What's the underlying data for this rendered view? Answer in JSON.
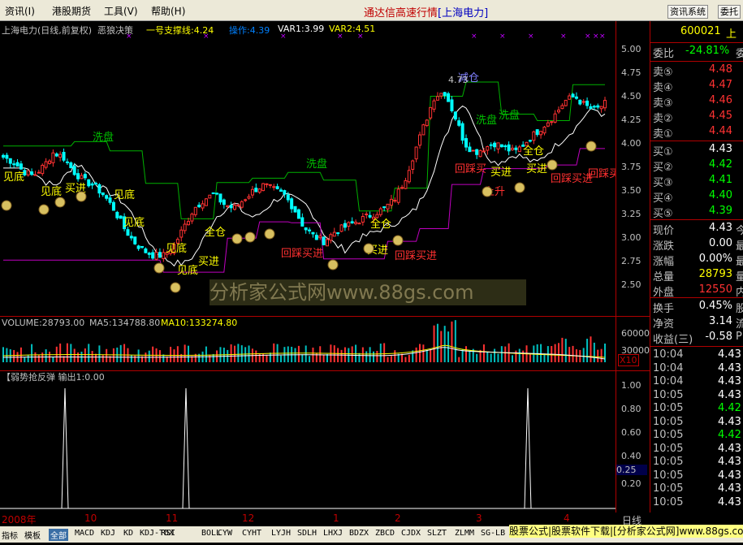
{
  "menu": {
    "items": [
      "资讯(I)",
      "港股期货",
      "工具(V)",
      "帮助(H)"
    ],
    "title": "通达信高速行情",
    "stock_label": "[上海电力]",
    "btn1": "资讯系统",
    "btn2": "委托"
  },
  "header": {
    "stock": "上海电力(日线,前复权)",
    "formula": "恶狼决策",
    "support": "一号支撑线:4.24",
    "op": "操作:4.39",
    "var1": "VAR1:3.99",
    "var2": "VAR2:4.51"
  },
  "price_axis": [
    "5.00",
    "4.75",
    "4.50",
    "4.25",
    "4.00",
    "3.75",
    "3.50",
    "3.25",
    "3.00",
    "2.75",
    "2.50"
  ],
  "volume": {
    "label": "VOLUME:28793.00",
    "ma5": "MA5:134788.80",
    "ma10": "MA10:133274.80",
    "axis": [
      "60000",
      "30000"
    ],
    "x10": "X10"
  },
  "indicator": {
    "label": "【弱势抢反弹 输出1:0.00",
    "axis": [
      "1.00",
      "0.80",
      "0.60",
      "0.40",
      "0.25",
      "0.20"
    ]
  },
  "annotations": {
    "xipan": "洗盘",
    "jiandi": "见底",
    "maijin": "买进",
    "quancang": "全仓",
    "huicai": "回踩买进",
    "jiancang": "减仓",
    "price_peak": "4.73",
    "shangsheng": "上升",
    "huicaimai": "回踩买"
  },
  "quote": {
    "code": "600021",
    "name_part": "上",
    "weibi_label": "委比",
    "weibi": "-24.81%",
    "weibi_ex": "委",
    "sells": [
      {
        "label": "卖⑤",
        "price": "4.48"
      },
      {
        "label": "卖④",
        "price": "4.47"
      },
      {
        "label": "卖③",
        "price": "4.46"
      },
      {
        "label": "卖②",
        "price": "4.45"
      },
      {
        "label": "卖①",
        "price": "4.44"
      }
    ],
    "buys": [
      {
        "label": "买①",
        "price": "4.43"
      },
      {
        "label": "买②",
        "price": "4.42"
      },
      {
        "label": "买③",
        "price": "4.41"
      },
      {
        "label": "买④",
        "price": "4.40"
      },
      {
        "label": "买⑤",
        "price": "4.39"
      }
    ],
    "stats": [
      {
        "label": "现价",
        "value": "4.43",
        "ex": "今"
      },
      {
        "label": "涨跌",
        "value": "0.00",
        "ex": "最"
      },
      {
        "label": "涨幅",
        "value": "0.00%",
        "ex": "最"
      },
      {
        "label": "总量",
        "value": "28793",
        "ex": "量"
      },
      {
        "label": "外盘",
        "value": "12550",
        "ex": "内"
      }
    ],
    "stats2": [
      {
        "label": "换手",
        "value": "0.45%",
        "ex": "股"
      },
      {
        "label": "净资",
        "value": "3.14",
        "ex": "流"
      },
      {
        "label": "收益(三)",
        "value": "-0.58",
        "ex": "P"
      }
    ],
    "ticks": [
      {
        "t": "10:04",
        "p": "4.43"
      },
      {
        "t": "10:04",
        "p": "4.43"
      },
      {
        "t": "10:04",
        "p": "4.43"
      },
      {
        "t": "10:05",
        "p": "4.43"
      },
      {
        "t": "10:05",
        "p": "4.42"
      },
      {
        "t": "10:05",
        "p": "4.43"
      },
      {
        "t": "10:05",
        "p": "4.42"
      },
      {
        "t": "10:05",
        "p": "4.43"
      },
      {
        "t": "10:05",
        "p": "4.43"
      },
      {
        "t": "10:05",
        "p": "4.43"
      },
      {
        "t": "10:05",
        "p": "4.43"
      },
      {
        "t": "10:05",
        "p": "4.43"
      }
    ]
  },
  "xaxis": {
    "labels": [
      "2008年",
      "10",
      "11",
      "12",
      "1",
      "2",
      "3",
      "4"
    ],
    "mode": "日线"
  },
  "tabs": [
    "指标",
    "模板",
    "全部",
    "MACD",
    "KDJ",
    "KD",
    "KDJ-TDX",
    "RSI",
    "BOLL",
    "CYW",
    "CYHT",
    "LYJH",
    "SDLH",
    "LHXJ",
    "BDZX",
    "ZBCD",
    "CJDX",
    "SLZT",
    "ZLMM",
    "SG-LB"
  ],
  "ad": "股票公式|股票软件下载|[分析家公式网]www.88gs.com",
  "watermark": "分析家公式网www.88gs.com",
  "colors": {
    "up": "#ff3232",
    "down": "#00ffff",
    "magenta": "#ff00ff",
    "yellow": "#ffff00",
    "green": "#00c000",
    "white": "#ffffff"
  }
}
